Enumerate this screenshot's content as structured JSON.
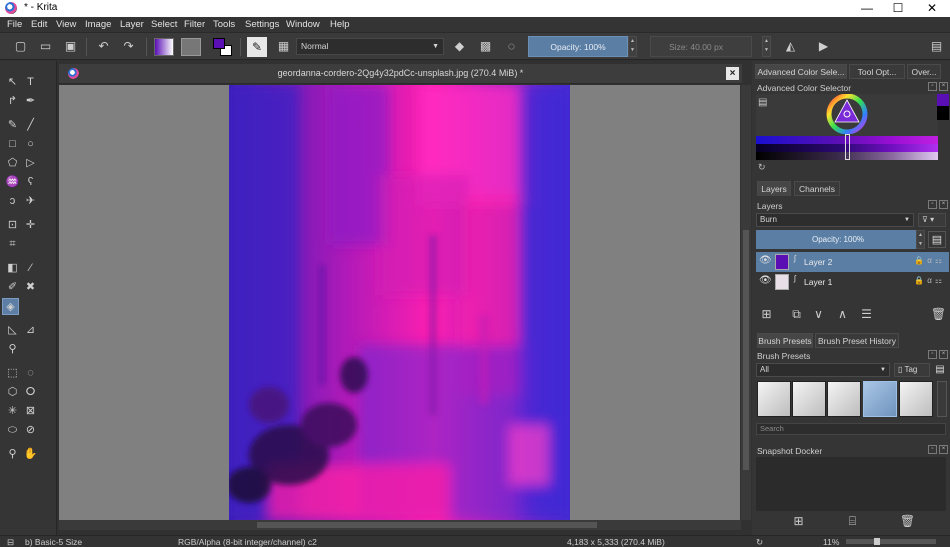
{
  "window": {
    "title": "* - Krita",
    "controls": {
      "minimize": "—",
      "maximize": "☐",
      "close": "✕"
    }
  },
  "menu": [
    "File",
    "Edit",
    "View",
    "Image",
    "Layer",
    "Select",
    "Filter",
    "Tools",
    "Settings",
    "Window",
    "Help"
  ],
  "toolbar": {
    "blend_mode": "Normal",
    "opacity": "Opacity: 100%",
    "size": "Size: 40.00 px",
    "colors": {
      "foreground": "#5a0fb4",
      "background": "#ffffff"
    }
  },
  "document": {
    "tab_title": "geordanna-cordero-2Qg4y32pdCc-unsplash.jpg (270.4 MiB) *",
    "close": "×"
  },
  "dock": {
    "top_tabs": [
      "Advanced Color Sele...",
      "Tool Opt...",
      "Over..."
    ],
    "color_selector_label": "Advanced Color Selector",
    "layer_tabs": [
      "Layers",
      "Channels"
    ],
    "layers_label": "Layers",
    "layer_blend": "Burn",
    "layer_opacity": "Opacity:  100%",
    "layers": [
      {
        "name": "Layer 2",
        "selected": true,
        "color": "#5a0fb4"
      },
      {
        "name": "Layer 1",
        "selected": false,
        "color": "#e8e0e6"
      }
    ],
    "preset_tabs": [
      "Brush Presets",
      "Brush Preset History"
    ],
    "presets_label": "Brush Presets",
    "preset_filter": "All",
    "preset_tag": "Tag",
    "search_placeholder": "Search",
    "snapshot_label": "Snapshot Docker"
  },
  "status": {
    "brush": "b) Basic-5 Size",
    "colorspace": "RGB/Alpha (8-bit integer/channel)  c2",
    "dimensions": "4,183 x 5,333 (270.4 MiB)",
    "zoom": "11%"
  }
}
